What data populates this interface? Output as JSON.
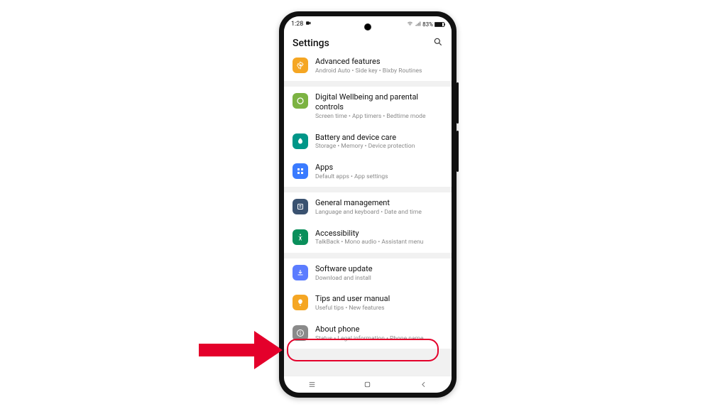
{
  "status": {
    "time": "1:28",
    "battery_pct": "83%"
  },
  "header": {
    "title": "Settings"
  },
  "items": [
    {
      "label": "Advanced features",
      "sub": "Android Auto  •  Side key  •  Bixby Routines",
      "color": "#f5a623",
      "icon": "gear"
    },
    {
      "label": "Digital Wellbeing and parental controls",
      "sub": "Screen time  •  App timers  •  Bedtime mode",
      "color": "#7cb342",
      "icon": "wellbeing"
    },
    {
      "label": "Battery and device care",
      "sub": "Storage  •  Memory  •  Device protection",
      "color": "#009688",
      "icon": "care"
    },
    {
      "label": "Apps",
      "sub": "Default apps  •  App settings",
      "color": "#3a7bff",
      "icon": "apps"
    },
    {
      "label": "General management",
      "sub": "Language and keyboard  •  Date and time",
      "color": "#3a5270",
      "icon": "general"
    },
    {
      "label": "Accessibility",
      "sub": "TalkBack  •  Mono audio  •  Assistant menu",
      "color": "#0a8f5b",
      "icon": "accessibility"
    },
    {
      "label": "Software update",
      "sub": "Download and install",
      "color": "#5b7cff",
      "icon": "update"
    },
    {
      "label": "Tips and user manual",
      "sub": "Useful tips  •  New features",
      "color": "#f5a623",
      "icon": "tips"
    },
    {
      "label": "About phone",
      "sub": "Status  •  Legal information  •  Phone name",
      "color": "#8a8a8a",
      "icon": "about"
    }
  ],
  "annotation": {
    "highlight_index": 8
  }
}
